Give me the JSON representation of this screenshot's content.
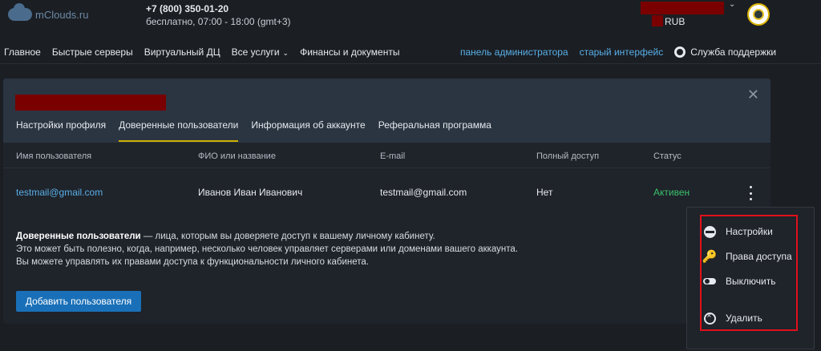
{
  "brand": {
    "logo_text": "mClouds.ru"
  },
  "contact": {
    "phone": "+7 (800) 350-01-20",
    "hours": "бесплатно, 07:00 - 18:00 (gmt+3)"
  },
  "account": {
    "currency": "RUB"
  },
  "nav": {
    "items": [
      {
        "label": "Главное"
      },
      {
        "label": "Быстрые серверы"
      },
      {
        "label": "Виртуальный ДЦ"
      },
      {
        "label": "Все услуги"
      },
      {
        "label": "Финансы и документы"
      }
    ],
    "admin_link": "панель администратора",
    "old_ui_link": "старый интерфейс",
    "support": "Служба поддержки"
  },
  "tabs": [
    {
      "label": "Настройки профиля"
    },
    {
      "label": "Доверенные пользователи"
    },
    {
      "label": "Информация об аккаунте"
    },
    {
      "label": "Реферальная программа"
    }
  ],
  "table": {
    "headers": [
      "Имя пользователя",
      "ФИО или название",
      "E-mail",
      "Полный доступ",
      "Статус"
    ],
    "rows": [
      {
        "username": "testmail@gmail.com",
        "fullname": "Иванов Иван Иванович",
        "email": "testmail@gmail.com",
        "full_access": "Нет",
        "status": "Активен"
      }
    ]
  },
  "description": {
    "bold": "Доверенные пользователи",
    "line1_rest": " — лица, которым вы доверяете доступ к вашему личному кабинету.",
    "line2": "Это может быть полезно, когда, например, несколько человек управляет серверами или доменами вашего аккаунта.",
    "line3": "Вы можете управлять их правами доступа к функциональности личного кабинета."
  },
  "add_button": "Добавить пользователя",
  "menu": {
    "items": [
      {
        "label": "Настройки",
        "icon": "settings-icon"
      },
      {
        "label": "Права доступа",
        "icon": "key-icon"
      },
      {
        "label": "Выключить",
        "icon": "toggle-icon"
      },
      {
        "label": "Удалить",
        "icon": "delete-icon"
      }
    ]
  },
  "colors": {
    "link": "#58aee6",
    "status_active": "#39c26a",
    "tab_underline": "#d0b000",
    "button": "#1a70b8",
    "highlight": "#e0101a",
    "redaction": "#7a0000"
  }
}
